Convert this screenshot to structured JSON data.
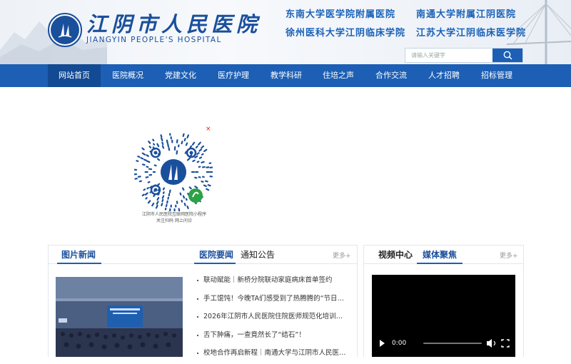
{
  "header": {
    "brand_cn": "江阴市人民医院",
    "brand_en": "JIANGYIN PEOPLE'S HOSPITAL",
    "affiliations": [
      "东南大学医学院附属医院",
      "南通大学附属江阴医院",
      "徐州医科大学江阴临床学院",
      "江苏大学江阴临床医学院"
    ]
  },
  "search": {
    "placeholder": "请输入关键字"
  },
  "nav": {
    "items": [
      "网站首页",
      "医院概况",
      "党建文化",
      "医疗护理",
      "教学科研",
      "住培之声",
      "合作交流",
      "人才招聘",
      "招标管理"
    ],
    "active_index": 0
  },
  "qr": {
    "close": "×",
    "caption_line1": "江阴市人民医院互联网医院小程序",
    "caption_line2": "关注扫码 网上问诊"
  },
  "panels": {
    "photo_news": {
      "title": "图片新闻"
    },
    "news": {
      "tabs": [
        "医院要闻",
        "通知公告"
      ],
      "more": "更多+",
      "items": [
        "联动赋能｜新桥分院联动家庭病床首单签约",
        "手工馄饨！今晚TA们感受到了热腾腾的“节日味道”",
        "2026年江阴市人民医院住院医师规范化培训招录工作启动",
        "舌下肿痛，一查竟然长了“结石”！",
        "校地合作再启新程｜南通大学与江阴市人民医院签约"
      ]
    },
    "media": {
      "tabs": [
        "视频中心",
        "媒体聚焦"
      ],
      "more": "更多+",
      "video_time": "0:00"
    }
  },
  "colors": {
    "brand": "#1a4f9c",
    "nav": "#1c5fb5",
    "nav_active": "#124a93"
  }
}
